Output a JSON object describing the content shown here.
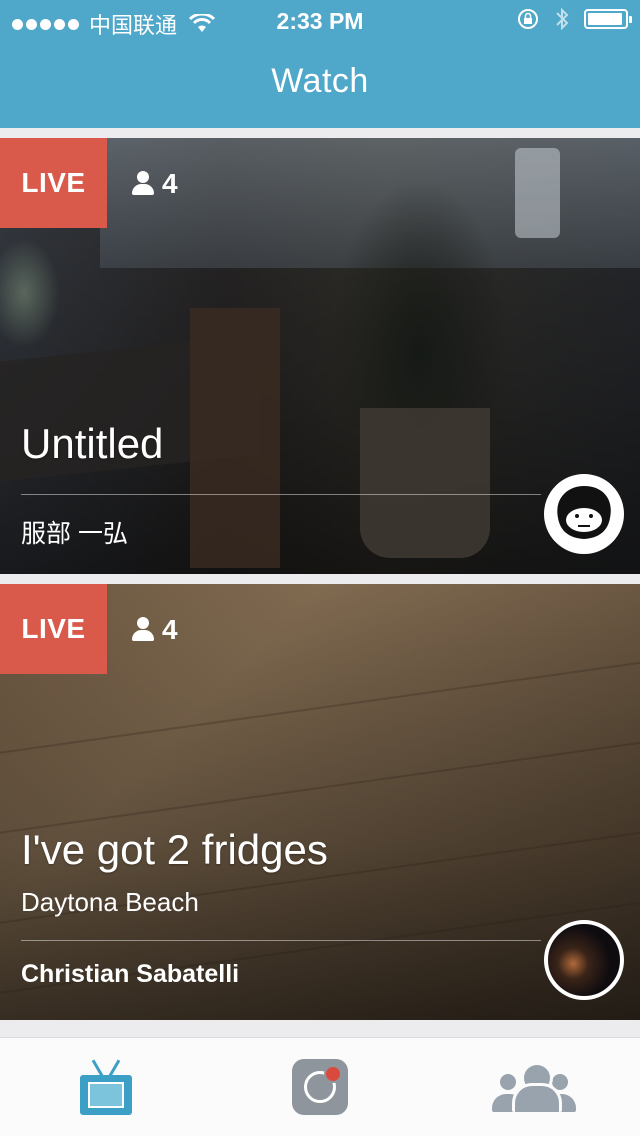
{
  "status_bar": {
    "carrier": "中国联通",
    "time": "2:33 PM"
  },
  "header": {
    "title": "Watch"
  },
  "broadcasts": [
    {
      "badge": "LIVE",
      "viewers": "4",
      "title": "Untitled",
      "location": "",
      "author": "服部 一弘"
    },
    {
      "badge": "LIVE",
      "viewers": "4",
      "title": "I've got 2 fridges",
      "location": "Daytona Beach",
      "author": "Christian Sabatelli"
    }
  ],
  "tabbar": {
    "tabs": [
      {
        "icon": "tv-icon",
        "active": true
      },
      {
        "icon": "broadcast-camera-icon",
        "active": false
      },
      {
        "icon": "people-icon",
        "active": false
      }
    ]
  },
  "colors": {
    "header_bg": "#4fa7c9",
    "live_badge": "#d9594a",
    "active_tab": "#3c9fc5"
  }
}
